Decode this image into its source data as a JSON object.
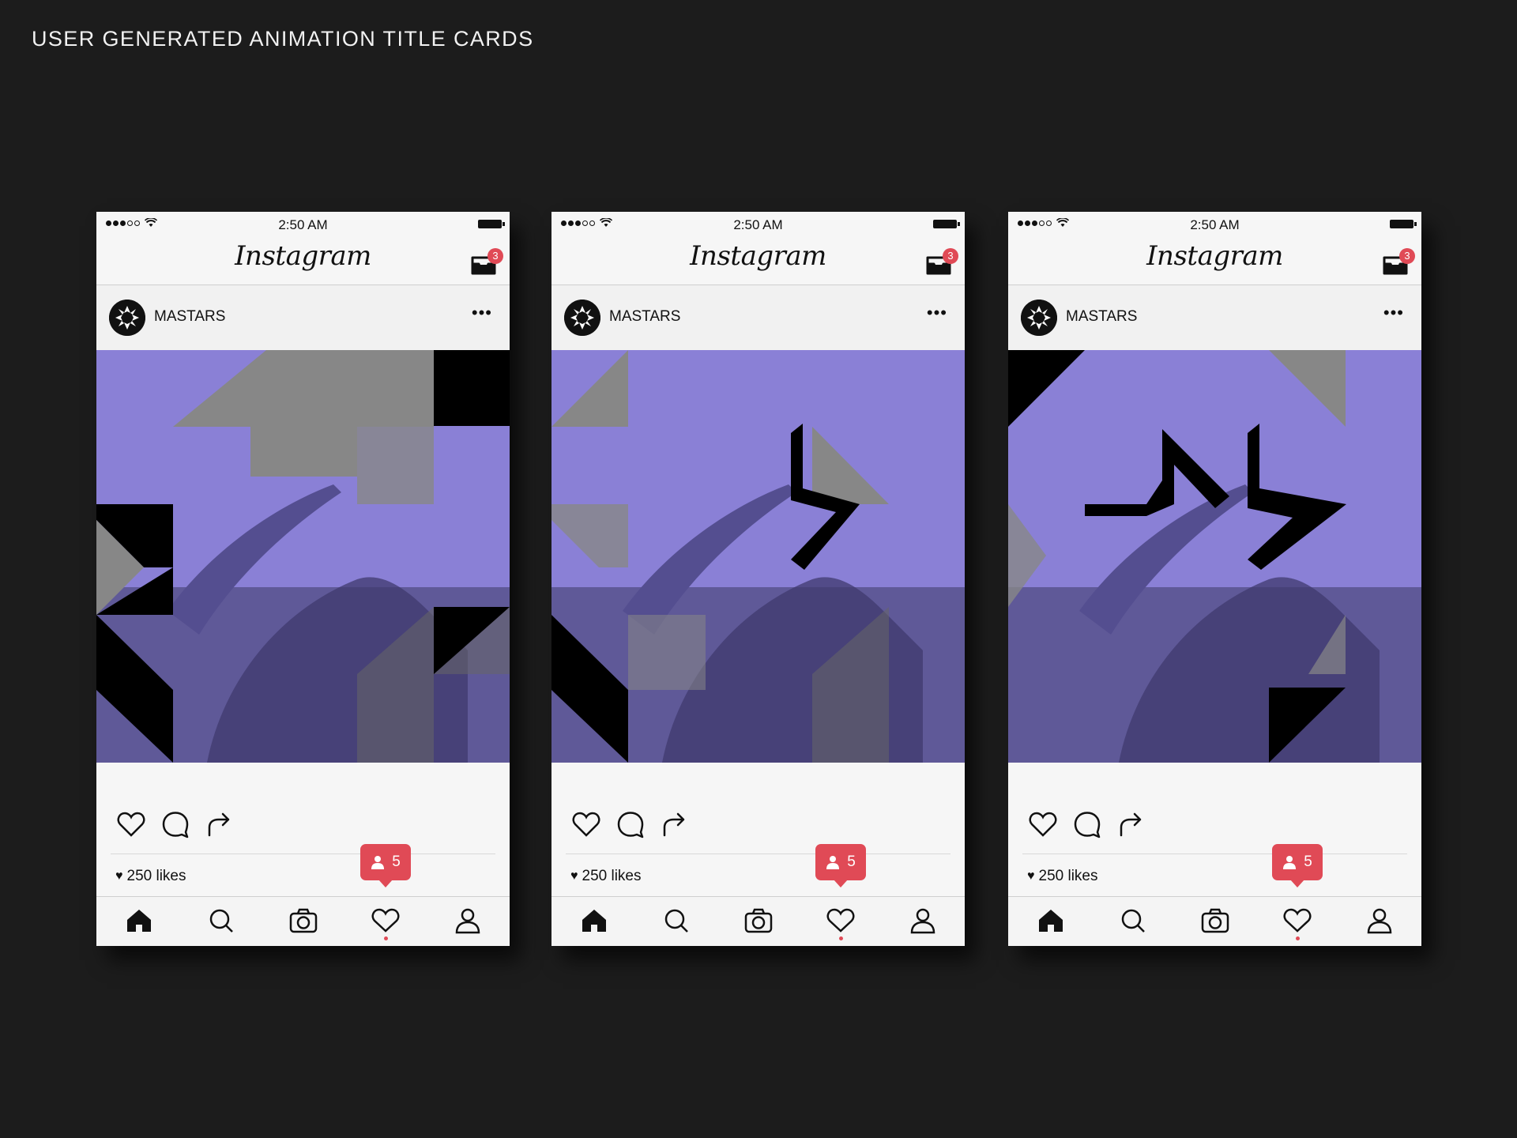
{
  "page": {
    "title": "USER GENERATED ANIMATION TITLE CARDS"
  },
  "colors": {
    "background": "#1c1c1c",
    "accent": "#e04a56",
    "photo_tint": "#8a80d6"
  },
  "phones": [
    {
      "status": {
        "time": "2:50 AM"
      },
      "header": {
        "logo": "Instagram",
        "inbox_badge": "3"
      },
      "post": {
        "username": "MASTARS",
        "likes": "250 likes"
      },
      "notification": {
        "count": "5"
      },
      "tabs": [
        "home-icon",
        "search-icon",
        "camera-icon",
        "heart-icon",
        "profile-icon"
      ]
    },
    {
      "status": {
        "time": "2:50 AM"
      },
      "header": {
        "logo": "Instagram",
        "inbox_badge": "3"
      },
      "post": {
        "username": "MASTARS",
        "likes": "250 likes"
      },
      "notification": {
        "count": "5"
      },
      "tabs": [
        "home-icon",
        "search-icon",
        "camera-icon",
        "heart-icon",
        "profile-icon"
      ]
    },
    {
      "status": {
        "time": "2:50 AM"
      },
      "header": {
        "logo": "Instagram",
        "inbox_badge": "3"
      },
      "post": {
        "username": "MASTARS",
        "likes": "250 likes"
      },
      "notification": {
        "count": "5"
      },
      "tabs": [
        "home-icon",
        "search-icon",
        "camera-icon",
        "heart-icon",
        "profile-icon"
      ]
    }
  ]
}
